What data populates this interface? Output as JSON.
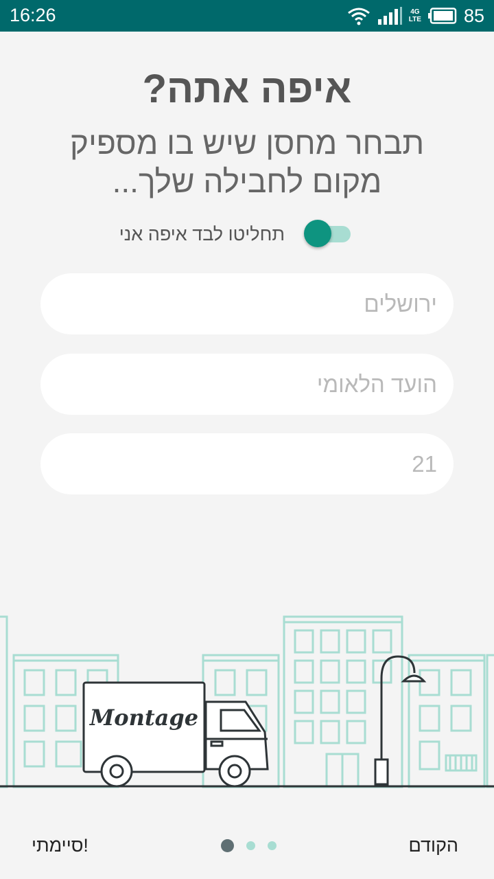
{
  "status_bar": {
    "time": "16:26",
    "network_top": "4G",
    "network_bottom": "LTE",
    "battery_percent": "85"
  },
  "header": {
    "title": "איפה אתה?",
    "subtitle": "תבחר מחסן שיש בו מספיק מקום לחבילה שלך..."
  },
  "toggle": {
    "label": "תחליטו לבד איפה אני",
    "checked": true
  },
  "form": {
    "city_placeholder": "ירושלים",
    "street_placeholder": "הועד הלאומי",
    "number_placeholder": "21"
  },
  "illustration": {
    "truck_logo": "Montage"
  },
  "footer": {
    "done_label": "סיימתי!",
    "prev_label": "הקודם",
    "pages": 3,
    "current_page": 1
  },
  "colors": {
    "status_bar": "#00696b",
    "accent": "#0e9480",
    "accent_light": "#a8ddd2",
    "building_line": "#a8ddd2",
    "truck_line": "#2e3437"
  }
}
